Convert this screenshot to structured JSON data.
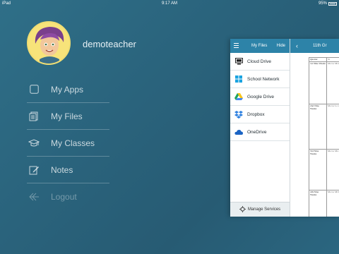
{
  "status_bar": {
    "carrier": "iPad",
    "time": "9:17 AM",
    "battery": "95%"
  },
  "profile": {
    "username": "demoteacher"
  },
  "menu": [
    {
      "label": "My Apps",
      "icon": "square-icon"
    },
    {
      "label": "My Files",
      "icon": "files-icon"
    },
    {
      "label": "My Classes",
      "icon": "graduation-cap-icon"
    },
    {
      "label": "Notes",
      "icon": "edit-icon"
    },
    {
      "label": "Logout",
      "icon": "logout-icon"
    }
  ],
  "files_panel": {
    "title": "My Files",
    "hide_label": "Hide",
    "services": [
      {
        "label": "Cloud Drive",
        "icon": "cloud-drive-icon"
      },
      {
        "label": "School Network",
        "icon": "windows-icon"
      },
      {
        "label": "Google Drive",
        "icon": "google-drive-icon"
      },
      {
        "label": "Dropbox",
        "icon": "dropbox-icon"
      },
      {
        "label": "OneDrive",
        "icon": "onedrive-icon"
      }
    ],
    "manage_label": "Manage Services"
  },
  "document": {
    "title": "11th Gr",
    "back_symbol": "‹",
    "table": {
      "header": [
        "Quarter",
        "St"
      ],
      "rows": [
        {
          "quarter": "1st Nine Weeks",
          "content": "Ma Gr Mi Pa Ma wi Mi Re Pa"
        },
        {
          "quarter": "2nd Nine Weeks",
          "content": "Ma Gr La wi Mi Ro Th Ma Re Pa"
        },
        {
          "quarter": "3rd Nine Weeks",
          "content": "Ma Gr Ma Qu Lo Mi Ma Vi Ko Pa"
        },
        {
          "quarter": "4th Nine Weeks",
          "content": "Ma Gr Mi Pa"
        }
      ]
    }
  }
}
